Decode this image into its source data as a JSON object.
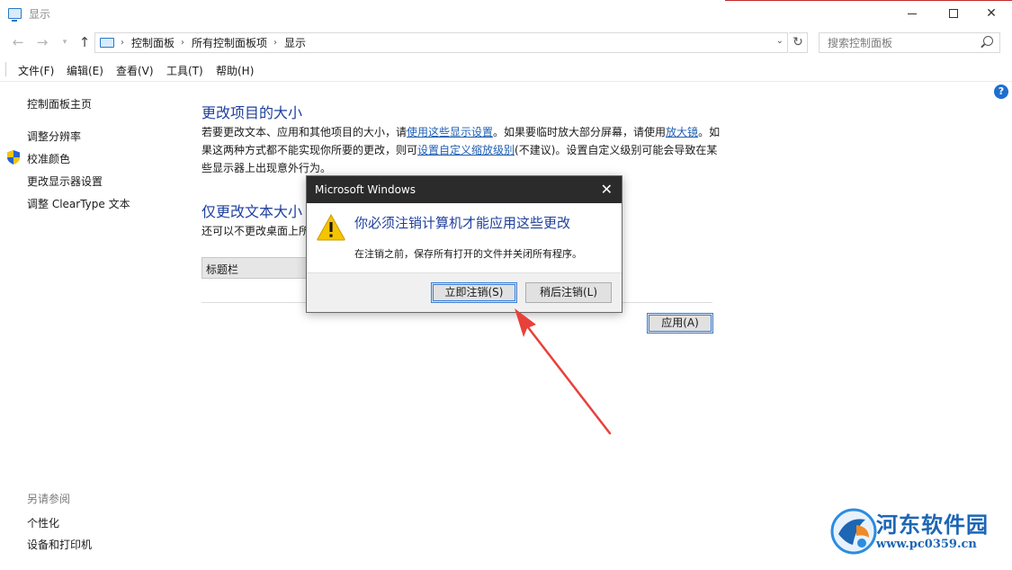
{
  "window": {
    "title": "显示",
    "controls": {
      "minimize": "minimize-icon",
      "maximize": "maximize-icon",
      "close": "close-icon"
    }
  },
  "address_bar": {
    "breadcrumbs": [
      "控制面板",
      "所有控制面板项",
      "显示"
    ],
    "search_placeholder": "搜索控制面板"
  },
  "menu": [
    "文件(F)",
    "编辑(E)",
    "查看(V)",
    "工具(T)",
    "帮助(H)"
  ],
  "sidebar": {
    "items": [
      "控制面板主页",
      "调整分辨率",
      "校准颜色",
      "更改显示器设置",
      "调整 ClearType 文本"
    ],
    "see_also_label": "另请参阅",
    "see_also": [
      "个性化",
      "设备和打印机"
    ]
  },
  "main": {
    "heading1": "更改项目的大小",
    "para1": {
      "t1": "若要更改文本、应用和其他项目的大小，请",
      "link1": "使用这些显示设置",
      "t2": "。如果要临时放大部分屏幕，请使用",
      "link2": "放大镜",
      "t3": "。如果这两种方式都不能实现你所要的更改，则可",
      "link3": "设置自定义缩放级别",
      "t4": "(不建议)。设置自定义级别可能会导致在某些显示器上出现意外行为。"
    },
    "heading2": "仅更改文本大小",
    "heading2_sub": "还可以不更改桌面上所",
    "combo_value": "标题栏",
    "apply_button": "应用(A)"
  },
  "dialog": {
    "title": "Microsoft Windows",
    "main_instruction": "你必须注销计算机才能应用这些更改",
    "content": "在注销之前，保存所有打开的文件并关闭所有程序。",
    "primary_button": "立即注销(S)",
    "secondary_button": "稍后注销(L)"
  },
  "watermark": {
    "name": "河东软件园",
    "url": "www.pc0359.cn"
  },
  "colors": {
    "heading": "#1e3f9e",
    "link": "#1e5fb4",
    "dialog_title_bg": "#2b2b2b",
    "focus_border": "#3c7fd6",
    "annotation_arrow": "#e8413a"
  }
}
